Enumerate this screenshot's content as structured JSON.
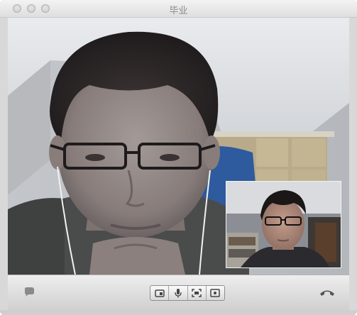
{
  "window": {
    "title": "毕业"
  },
  "main_video": {
    "label": ""
  },
  "self_view": {
    "label": ""
  },
  "controls": {
    "chat_icon": "chat-bubble-icon",
    "camera_switch_icon": "camera-icon",
    "mute_icon": "microphone-icon",
    "fullscreen_icon": "fullscreen-icon",
    "screen_share_icon": "screen-icon",
    "end_call_icon": "phone-hangup-icon"
  },
  "colors": {
    "titlebar": "#e9e9e9",
    "title_text": "#8a8a8a",
    "controlbar": "#dcdcdc",
    "icon": "#555555"
  }
}
